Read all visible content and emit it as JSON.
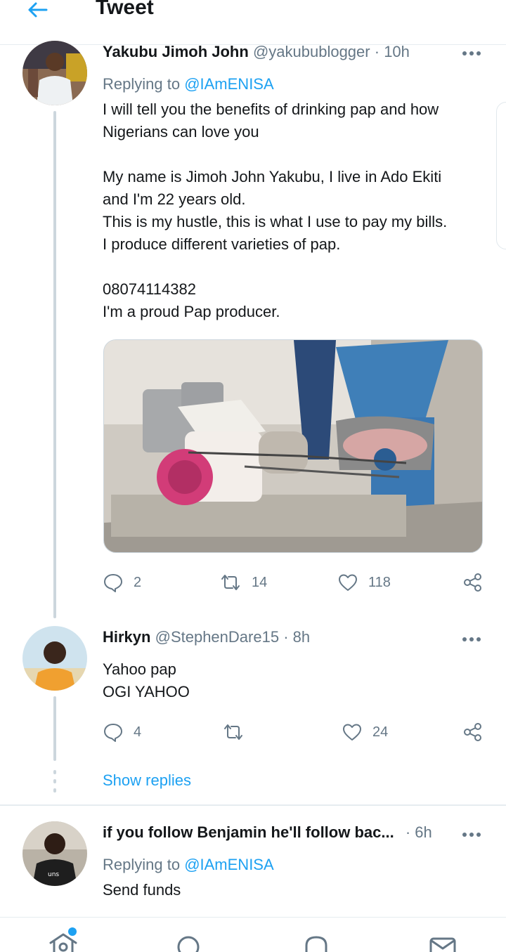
{
  "header": {
    "title": "Tweet"
  },
  "colors": {
    "accent": "#1da1f2",
    "secondary_text": "#657786",
    "thread_line": "#ccd6dd"
  },
  "tweets": [
    {
      "name": "Yakubu Jimoh John",
      "handle": "@yakubublogger",
      "sep": "·",
      "time": "10h",
      "replying_prefix": "Replying to ",
      "replying_to": "@IAmENISA",
      "text_lines": [
        "I will tell you the benefits of drinking pap and how",
        "Nigerians can love you",
        "",
        "My name is Jimoh John Yakubu, I live in Ado Ekiti",
        "and I'm 22 years old.",
        "This is my hustle, this is what I use to pay my bills.",
        "I produce different varieties of pap.",
        "",
        "08074114382",
        "I'm a proud Pap producer."
      ],
      "replies": "2",
      "retweets": "14",
      "likes": "118"
    },
    {
      "name": "Hirkyn",
      "handle": "@StephenDare15",
      "sep": "·",
      "time": "8h",
      "text_lines": [
        "Yahoo pap",
        "OGI YAHOO"
      ],
      "replies": "4",
      "retweets": "",
      "likes": "24"
    },
    {
      "name": "if you follow Benjamin he'll follow bac...",
      "sep": "·",
      "time": "6h",
      "replying_prefix": "Replying to ",
      "replying_to": "@IAmENISA",
      "text_lines": [
        "Send funds"
      ]
    }
  ],
  "show_replies": "Show replies",
  "avatar_badge_text": "uns",
  "icons": {
    "back": "arrow-left-icon",
    "more": "more-dots-icon",
    "reply": "reply-bubble-icon",
    "retweet": "retweet-icon",
    "like": "heart-icon",
    "share": "share-icon",
    "home": "home-icon",
    "search": "search-icon",
    "notifications": "bell-icon",
    "messages": "mail-icon"
  }
}
